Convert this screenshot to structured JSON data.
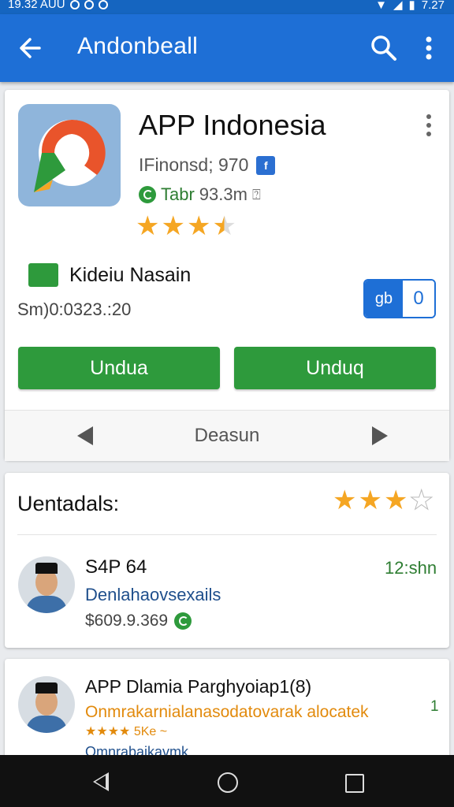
{
  "status_bar": {
    "left_text": "19.32 AUU",
    "right_text": "7.27"
  },
  "app_bar": {
    "title": "Andonbeall",
    "icons": [
      "back-arrow-icon",
      "search-icon",
      "more-vert-icon"
    ]
  },
  "app": {
    "name": "APP Indonesia",
    "meta": "IFinonsd; 970",
    "badge": "f",
    "size_label": "Tabr",
    "size_value": "93.3m",
    "rating_stars": 3.5
  },
  "developer": {
    "name": "Kideiu Nasain",
    "date": "Sm)0:0323.:20"
  },
  "toggle": {
    "on_label": "gb",
    "off_label": "0"
  },
  "buttons": {
    "primary": "Undua",
    "secondary": "Unduq"
  },
  "pager": {
    "label": "Deasun"
  },
  "reviews": {
    "title": "Uentadals:",
    "stars": 3,
    "items": [
      {
        "name": "S4P 64",
        "time": "12:shn",
        "text": "Denlahaovsexails",
        "meta": "$609.9.369"
      },
      {
        "name": "APP Dlamia Parghyoiap1(8)",
        "count": "1",
        "text": "Onmrakarnialanasodatovarak alocatek",
        "rating_text": "★★★★ 5Ke ~",
        "more": "Omnrabaikavmk"
      }
    ]
  },
  "colors": {
    "primary": "#1e6fd6",
    "green": "#2e9a3c",
    "star": "#f5a623"
  }
}
